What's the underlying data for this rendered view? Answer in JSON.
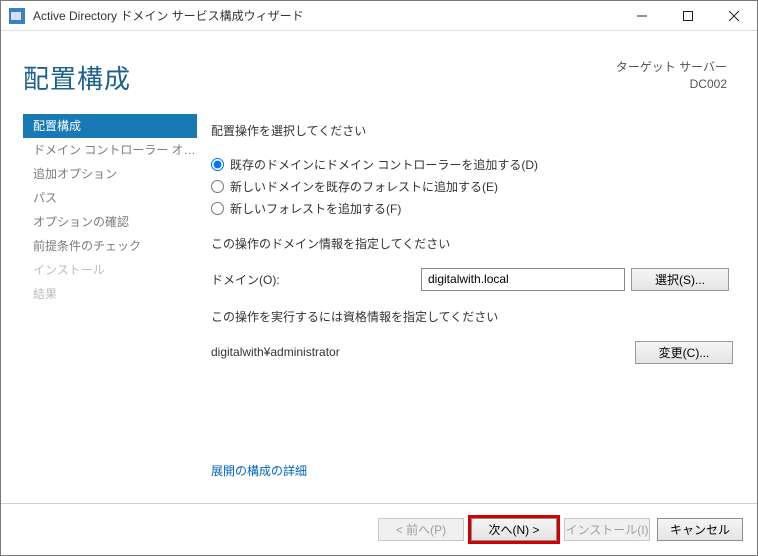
{
  "window_title": "Active Directory ドメイン サービス構成ウィザード",
  "header": {
    "title": "配置構成",
    "target_label": "ターゲット サーバー",
    "target_server": "DC002"
  },
  "sidebar": {
    "items": [
      {
        "label": "配置構成",
        "state": "active"
      },
      {
        "label": "ドメイン コントローラー オプシ...",
        "state": "normal"
      },
      {
        "label": "追加オプション",
        "state": "normal"
      },
      {
        "label": "パス",
        "state": "normal"
      },
      {
        "label": "オプションの確認",
        "state": "normal"
      },
      {
        "label": "前提条件のチェック",
        "state": "normal"
      },
      {
        "label": "インストール",
        "state": "disabled"
      },
      {
        "label": "結果",
        "state": "disabled"
      }
    ]
  },
  "content": {
    "select_op_label": "配置操作を選択してください",
    "radio1": "既存のドメインにドメイン コントローラーを追加する(D)",
    "radio2": "新しいドメインを既存のフォレストに追加する(E)",
    "radio3": "新しいフォレストを追加する(F)",
    "domain_info_label": "この操作のドメイン情報を指定してください",
    "domain_label": "ドメイン(O):",
    "domain_value": "digitalwith.local",
    "select_button": "選択(S)...",
    "cred_info_label": "この操作を実行するには資格情報を指定してください",
    "credential_value": "digitalwith¥administrator",
    "change_button": "変更(C)...",
    "more_link": "展開の構成の詳細"
  },
  "footer": {
    "prev": "< 前へ(P)",
    "next": "次へ(N) >",
    "install": "インストール(I)",
    "cancel": "キャンセル"
  }
}
